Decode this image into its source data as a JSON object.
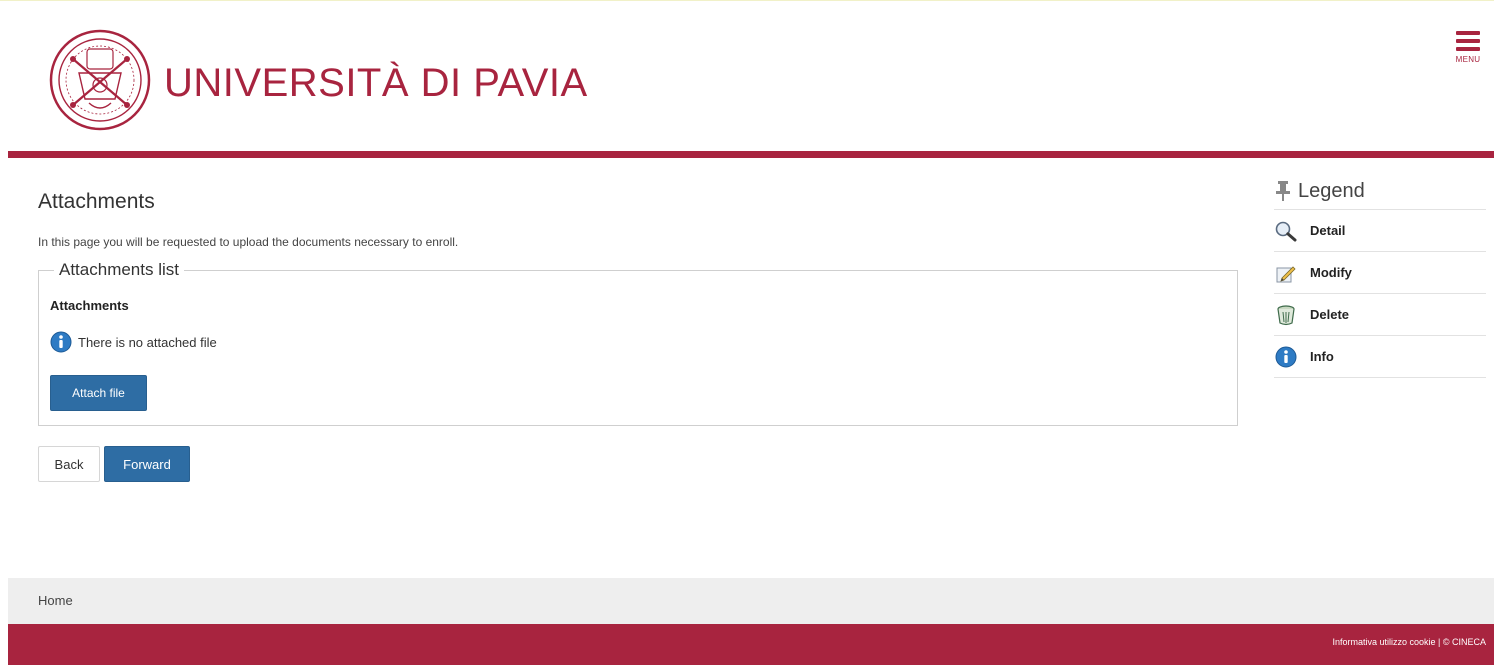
{
  "brand": {
    "name": "UNIVERSITÀ DI PAVIA",
    "color": "#a8243f"
  },
  "header": {
    "menu_label": "MENU"
  },
  "page": {
    "title": "Attachments",
    "intro": "In this page you will be requested to upload the documents necessary to enroll."
  },
  "attachments_list": {
    "legend": "Attachments list",
    "heading": "Attachments",
    "empty_message": "There is no attached file",
    "attach_button": "Attach file"
  },
  "navigation": {
    "back_label": "Back",
    "forward_label": "Forward"
  },
  "legend": {
    "title": "Legend",
    "items": [
      {
        "label": "Detail",
        "icon": "magnifier-icon"
      },
      {
        "label": "Modify",
        "icon": "pencil-icon"
      },
      {
        "label": "Delete",
        "icon": "trash-icon"
      },
      {
        "label": "Info",
        "icon": "info-icon"
      }
    ]
  },
  "footer": {
    "home_label": "Home",
    "cookie_label": "Informativa utilizzo cookie",
    "separator": "|",
    "copyright": "© CINECA"
  },
  "colors": {
    "accent": "#a8243f",
    "primary_button": "#2e6da4",
    "footer_nav_bg": "#eeeeee"
  }
}
